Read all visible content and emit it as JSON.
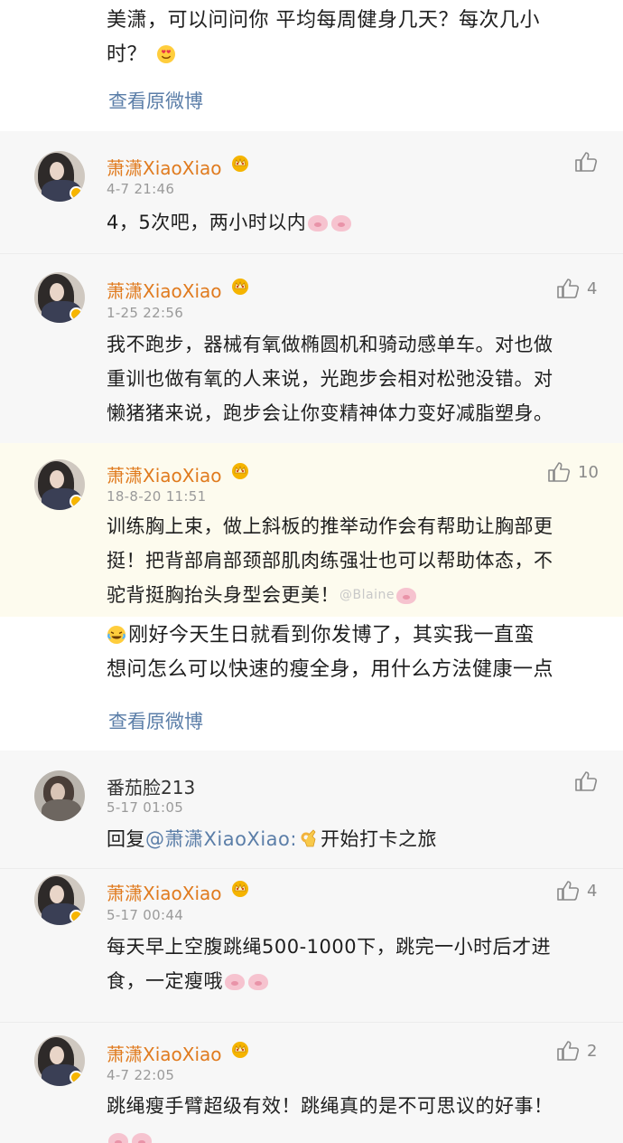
{
  "top_post": {
    "text_line1": "美潇，可以问问你 平均每周健身几天？每次几小",
    "text_line2": "时？",
    "view_original": "查看原微博"
  },
  "thread1": [
    {
      "name": "萧潇XiaoXiao",
      "time": "4-7 21:46",
      "likes": "",
      "lines": [
        "4，5次吧，两小时以内"
      ]
    },
    {
      "name": "萧潇XiaoXiao",
      "time": "1-25 22:56",
      "likes": "4",
      "lines": [
        "我不跑步，器械有氧做椭圆机和骑动感单车。对也做",
        "重训也做有氧的人来说，光跑步会相对松弛没错。对",
        "懒猪猪来说，跑步会让你变精神体力变好减脂塑身。"
      ]
    },
    {
      "name": "萧潇XiaoXiao",
      "time": "18-8-20 11:51",
      "likes": "10",
      "lines": [
        "训练胸上束，做上斜板的推举动作会有帮助让胸部更",
        "挺！把背部肩部颈部肌肉练强壮也可以帮助体态，不",
        "驼背挺胸抬头身型会更美！"
      ]
    }
  ],
  "watermark": "@Blaine",
  "second_post": {
    "text_line1": "刚好今天生日就看到你发博了，其实我一直蛮",
    "text_line2": "想问怎么可以快速的瘦全身，用什么方法健康一点",
    "view_original": "查看原微博"
  },
  "thread2": [
    {
      "name": "番茄脸213",
      "time": "5-17 01:05",
      "likes": "",
      "reply_prefix": "回复",
      "mention": "@萧潇XiaoXiao:",
      "reply_text": "开始打卡之旅"
    },
    {
      "name": "萧潇XiaoXiao",
      "time": "5-17 00:44",
      "likes": "4",
      "lines": [
        "每天早上空腹跳绳500-1000下，跳完一小时后才进",
        "食，一定瘦哦"
      ]
    },
    {
      "name": "萧潇XiaoXiao",
      "time": "4-7 22:05",
      "likes": "2",
      "lines": [
        "跳绳瘦手臂超级有效！跳绳真的是不可思议的好事！"
      ]
    }
  ],
  "colors": {
    "name_orange": "#e07b1f",
    "link_blue": "#5b7ea8",
    "meta_gray": "#9a9a9a"
  },
  "icons": [
    "heart-eyes-emoji",
    "crown-badge-icon",
    "thumbs-up-icon",
    "pig-emoji",
    "crying-laugh-emoji",
    "ok-hand-emoji",
    "verified-badge-icon"
  ]
}
